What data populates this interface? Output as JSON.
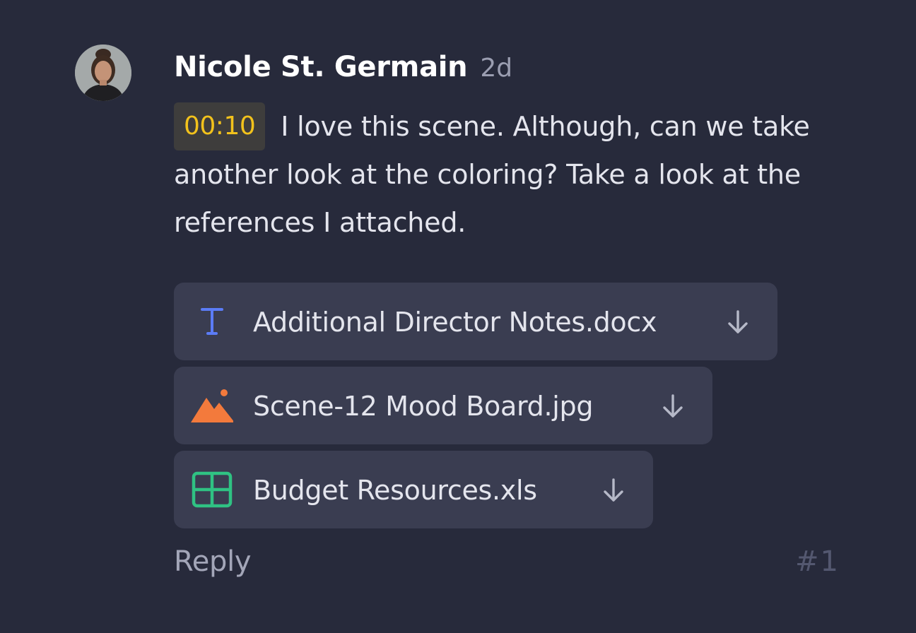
{
  "comment": {
    "author": "Nicole St. Germain",
    "age": "2d",
    "timestamp": "00:10",
    "text": "I love this scene. Although, can we take another look at the coloring? Take a look at the references I attached.",
    "attachments": [
      {
        "name": "Additional Director Notes.docx",
        "icon": "text-document-icon",
        "color": "#5b7cf6"
      },
      {
        "name": "Scene-12 Mood Board.jpg",
        "icon": "image-icon",
        "color": "#f37a3c"
      },
      {
        "name": "Budget Resources.xls",
        "icon": "spreadsheet-icon",
        "color": "#2fc283"
      }
    ],
    "reply_label": "Reply",
    "number": "#1"
  },
  "colors": {
    "background": "#272a3b",
    "attachment_bg": "#3a3d51",
    "timestamp_bg": "#3e3d3c",
    "timestamp_text": "#f2c21c"
  }
}
